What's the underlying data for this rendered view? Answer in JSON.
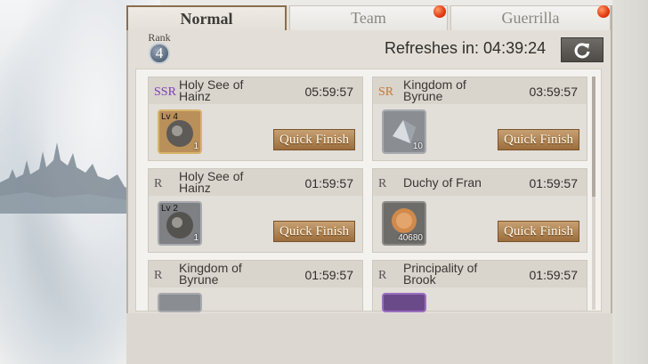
{
  "tabs": [
    {
      "label": "Normal",
      "active": true
    },
    {
      "label": "Team",
      "active": false,
      "notification": true
    },
    {
      "label": "Guerrilla",
      "active": false,
      "notification": true
    }
  ],
  "rank": {
    "label": "Rank",
    "value": "4"
  },
  "refresh": {
    "label": "Refreshes in: 04:39:24",
    "icon": "refresh-icon"
  },
  "missions": [
    {
      "rarity": "SSR",
      "rarity_color": "#7a3fb8",
      "name": "Holy See of Hainz",
      "timer": "05:59:57",
      "item_level": "Lv 4",
      "item_count": "1",
      "button": "Quick Finish"
    },
    {
      "rarity": "SR",
      "rarity_color": "#c7782e",
      "name": "Kingdom of Byrune",
      "timer": "03:59:57",
      "item_level": "",
      "item_count": "10",
      "button": "Quick Finish"
    },
    {
      "rarity": "R",
      "rarity_color": "#555555",
      "name": "Holy See of Hainz",
      "timer": "01:59:57",
      "item_level": "Lv 2",
      "item_count": "1",
      "button": "Quick Finish"
    },
    {
      "rarity": "R",
      "rarity_color": "#555555",
      "name": "Duchy of Fran",
      "timer": "01:59:57",
      "item_level": "",
      "item_count": "40680",
      "button": "Quick Finish"
    },
    {
      "rarity": "R",
      "rarity_color": "#555555",
      "name": "Kingdom of Byrune",
      "timer": "01:59:57"
    },
    {
      "rarity": "R",
      "rarity_color": "#555555",
      "name": "Principality of Brook",
      "timer": "01:59:57"
    }
  ]
}
